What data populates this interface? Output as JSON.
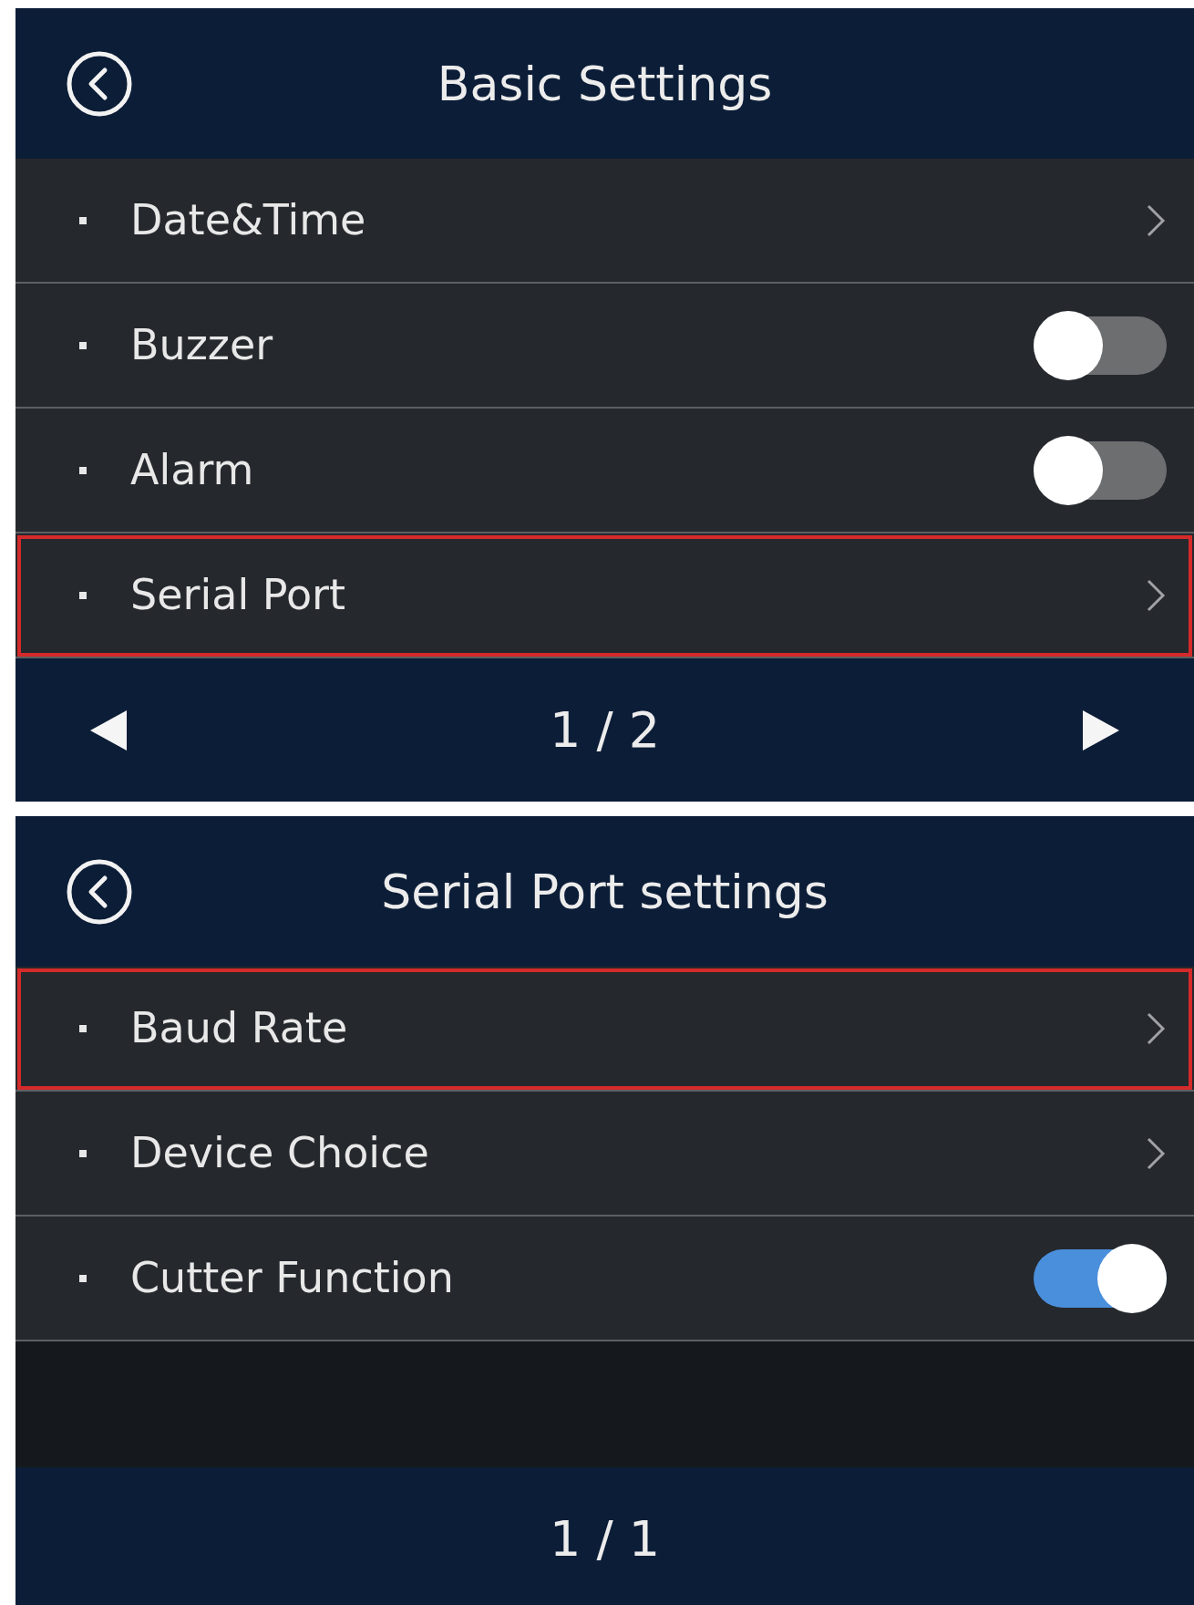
{
  "panels": [
    {
      "title": "Basic Settings",
      "rows": [
        {
          "label": "Date&Time",
          "kind": "link",
          "highlighted": false
        },
        {
          "label": "Buzzer",
          "kind": "toggle",
          "on": false,
          "highlighted": false
        },
        {
          "label": "Alarm",
          "kind": "toggle",
          "on": false,
          "highlighted": false
        },
        {
          "label": "Serial Port",
          "kind": "link",
          "highlighted": true
        }
      ],
      "empty_area": false,
      "pager": {
        "text": "1 / 2",
        "arrows": true
      }
    },
    {
      "title": "Serial Port settings",
      "rows": [
        {
          "label": "Baud Rate",
          "kind": "link",
          "highlighted": true
        },
        {
          "label": "Device Choice",
          "kind": "link",
          "highlighted": false
        },
        {
          "label": "Cutter Function",
          "kind": "toggle",
          "on": true,
          "highlighted": false
        }
      ],
      "empty_area": true,
      "pager": {
        "text": "1 / 1",
        "arrows": false
      }
    }
  ]
}
